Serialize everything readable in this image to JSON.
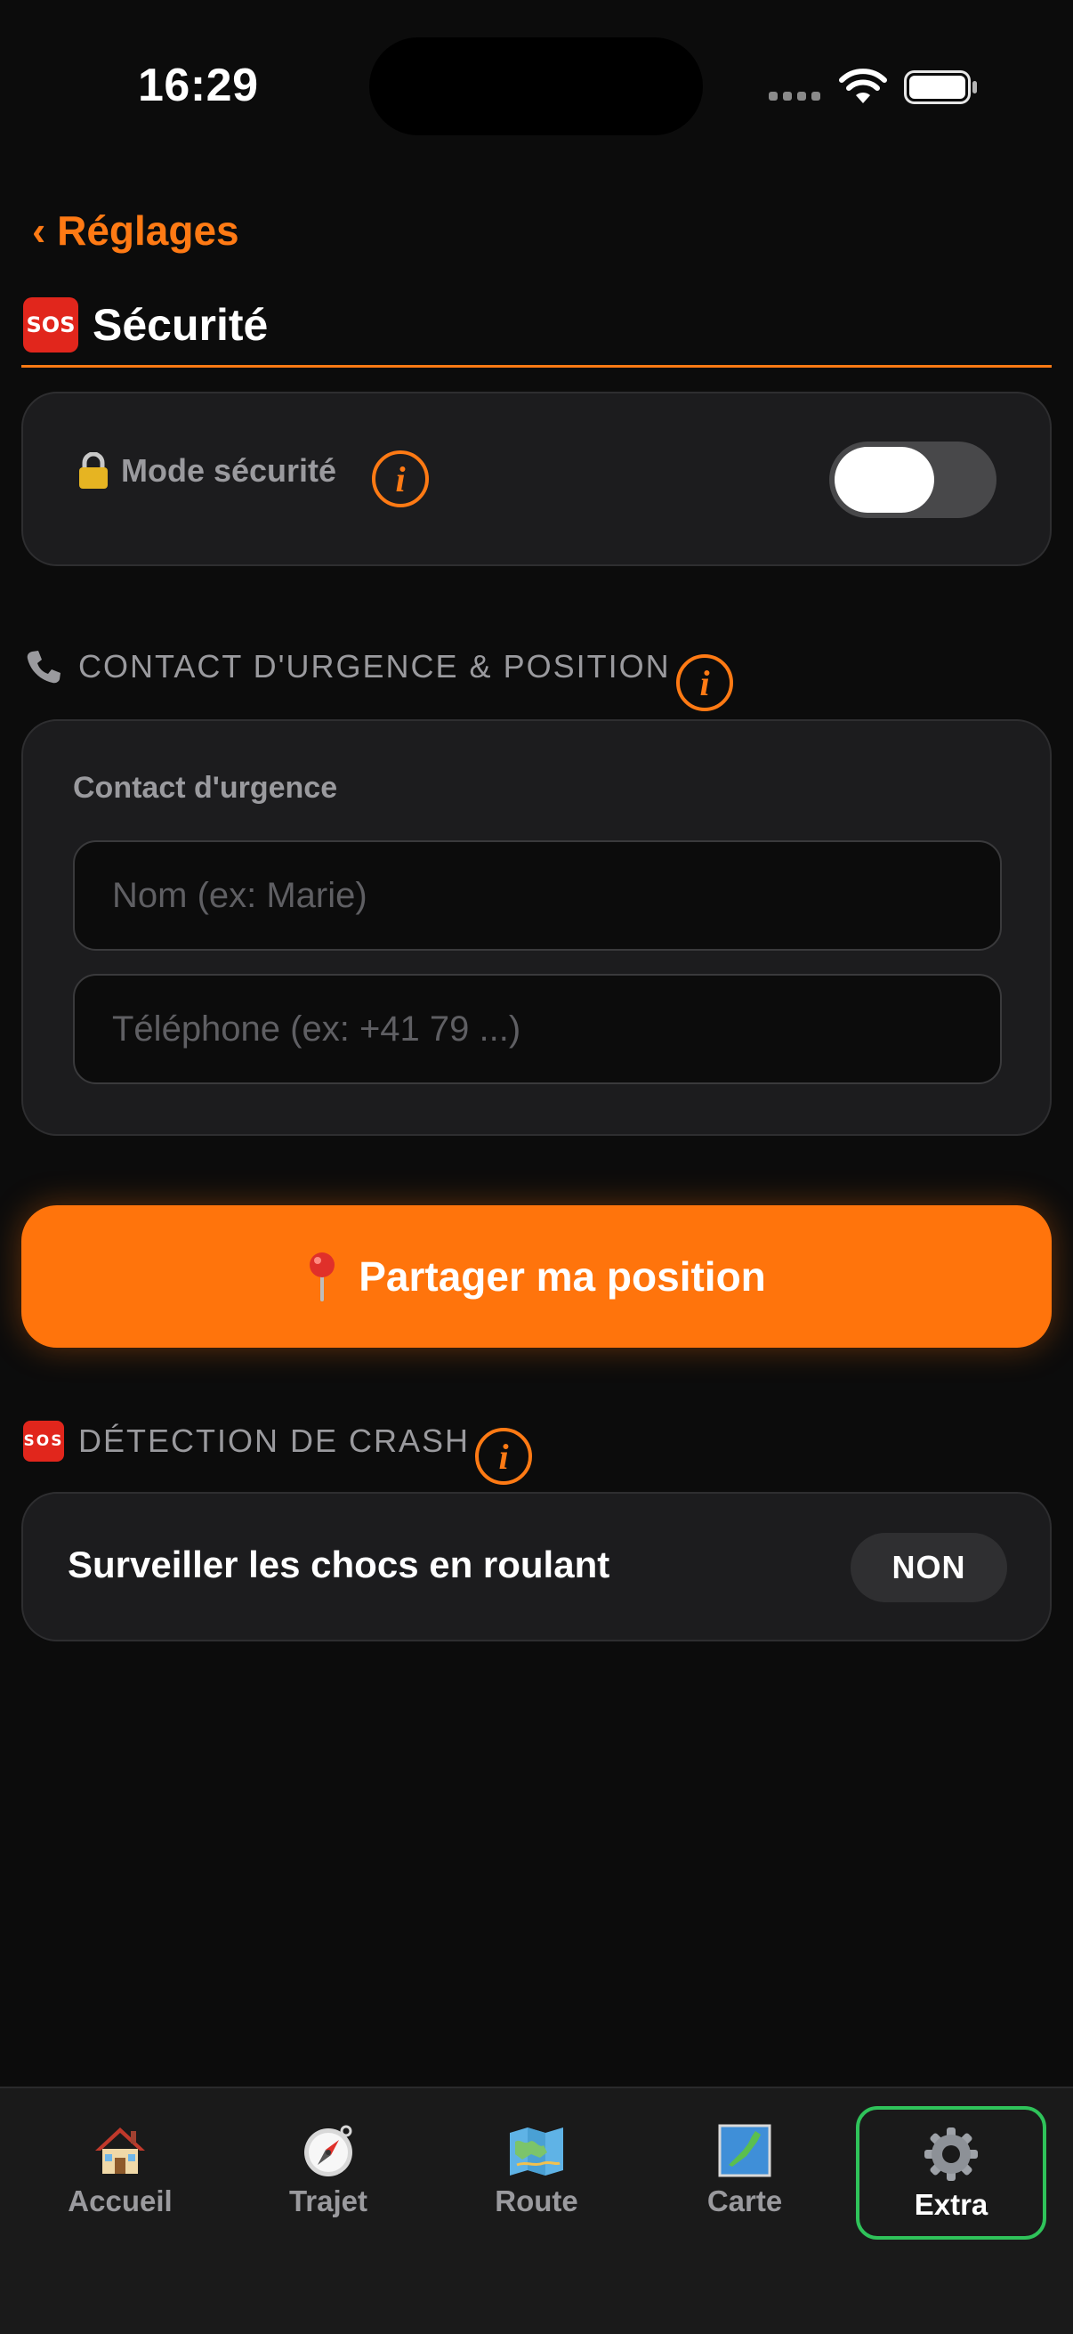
{
  "status_bar": {
    "time": "16:29"
  },
  "header": {
    "back_label": "‹ Réglages",
    "title_badge": "SOS",
    "title": "Sécurité"
  },
  "security_mode": {
    "label": "Mode sécurité",
    "info_glyph": "i",
    "toggle_on": true
  },
  "contact_section": {
    "header": "CONTACT D'URGENCE & POSITION",
    "info_glyph": "i",
    "card_label": "Contact d'urgence",
    "name_placeholder": "Nom (ex: Marie)",
    "phone_placeholder": "Téléphone (ex: +41 79 ...)",
    "name_value": "",
    "phone_value": ""
  },
  "share_button": {
    "label": "Partager ma position"
  },
  "crash_section": {
    "header_badge": "SOS",
    "header": "DÉTECTION DE CRASH",
    "info_glyph": "i",
    "monitor_label": "Surveiller les chocs en roulant",
    "monitor_state": "NON"
  },
  "tab_bar": {
    "tabs": [
      {
        "label": "Accueil",
        "icon": "house-icon"
      },
      {
        "label": "Trajet",
        "icon": "compass-icon"
      },
      {
        "label": "Route",
        "icon": "map-icon"
      },
      {
        "label": "Carte",
        "icon": "japan-map-icon"
      },
      {
        "label": "Extra",
        "icon": "gear-icon",
        "active": true
      }
    ]
  },
  "colors": {
    "accent": "#ff7a14",
    "background": "#0c0c0c",
    "card": "#1c1c1e",
    "active_tab_border": "#2fc35a"
  }
}
